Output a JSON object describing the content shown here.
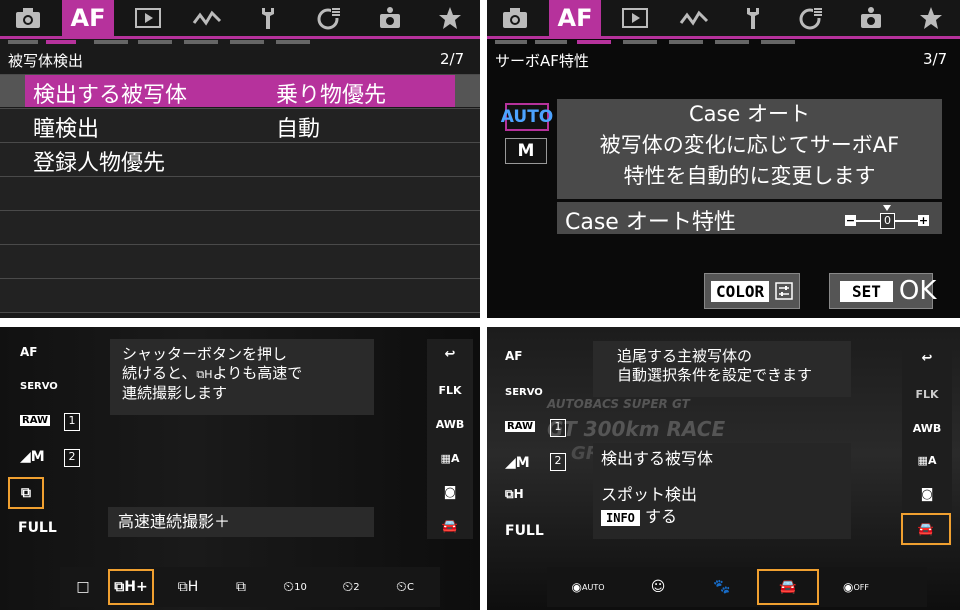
{
  "panel1": {
    "tabs": [
      "camera-icon",
      "AF",
      "play-icon",
      "wave-icon",
      "wrench-icon",
      "custom-icon",
      "camera-person-icon",
      "star-icon"
    ],
    "active_tab": "AF",
    "section_title": "被写体検出",
    "page": "2/7",
    "rows": [
      {
        "label": "検出する被写体",
        "value": "乗り物優先",
        "selected": true
      },
      {
        "label": "瞳検出",
        "value": "自動",
        "selected": false
      },
      {
        "label": "登録人物優先",
        "value": "",
        "selected": false
      }
    ]
  },
  "panel2": {
    "active_tab": "AF",
    "section_title": "サーボAF特性",
    "page": "3/7",
    "modes": [
      "AUTO",
      "M"
    ],
    "desc_line1": "Case オート",
    "desc_line2": "被写体の変化に応じてサーボAF",
    "desc_line3": "特性を自動的に変更します",
    "characteristic_label": "Case オート特性",
    "slider_value": "0",
    "color_button": "COLOR",
    "set_button": "SET",
    "ok_label": "OK"
  },
  "panel3": {
    "left_icons": [
      "AF",
      "SERVO",
      "RAW",
      "M",
      "",
      "FULL"
    ],
    "info_text_line1": "シャッターボタンを押し",
    "info_text_line2": "続けると、",
    "info_text_line2b": "よりも高速で",
    "info_text_line3": "連続撮影します",
    "card1": "1",
    "card2": "2",
    "right_icons": [
      "FLK",
      "AWB"
    ],
    "mode_label": "高速連続撮影＋",
    "bottom_icons": [
      "single",
      "high-plus",
      "high",
      "low",
      "10",
      "2",
      "C"
    ]
  },
  "panel4": {
    "info_line1": "追尾する主被写体の",
    "info_line2": "自動選択条件を設定できます",
    "detect_label": "検出する被写体",
    "spot_label": "スポット検出",
    "info_key": "INFO",
    "info_suffix": "する",
    "left_icons": [
      "AF",
      "SERVO",
      "RAW",
      "M",
      "",
      "FULL"
    ],
    "card1": "1",
    "card2": "2",
    "right_icons": [
      "FLK",
      "AWB"
    ],
    "bottom_icons": [
      "AUTO",
      "person",
      "animal",
      "vehicle",
      "OFF"
    ],
    "background_text1": "AUTOBACS SUPER GT",
    "background_text2": "GT 300km RACE",
    "background_text3": "GRAND FINAL"
  }
}
